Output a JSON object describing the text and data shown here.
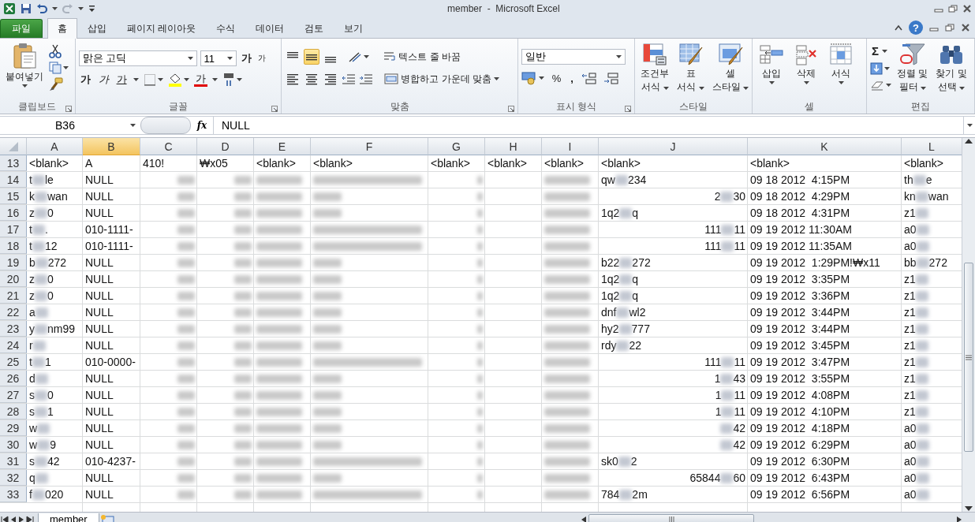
{
  "window": {
    "title": "member  -  Microsoft Excel"
  },
  "ribbon_tabs": [
    {
      "label": "파일",
      "kind": "file",
      "selected": false
    },
    {
      "label": "홈",
      "kind": "tab",
      "selected": true
    },
    {
      "label": "삽입",
      "kind": "tab",
      "selected": false
    },
    {
      "label": "페이지 레이아웃",
      "kind": "tab",
      "selected": false
    },
    {
      "label": "수식",
      "kind": "tab",
      "selected": false
    },
    {
      "label": "데이터",
      "kind": "tab",
      "selected": false
    },
    {
      "label": "검토",
      "kind": "tab",
      "selected": false
    },
    {
      "label": "보기",
      "kind": "tab",
      "selected": false
    }
  ],
  "help": "?",
  "clipboard": {
    "label": "클립보드",
    "paste": "붙여넣기"
  },
  "font": {
    "label": "글꼴",
    "family": "맑은 고딕",
    "size": "11",
    "grow": "가",
    "shrink": "가",
    "bold": "가",
    "italic": "가",
    "underline": "가",
    "color_letter": "가"
  },
  "alignment": {
    "label": "맞춤",
    "vertical": [
      {
        "selected": false
      },
      {
        "selected": true
      },
      {
        "selected": false
      }
    ],
    "wrap": "텍스트 줄 바꿈",
    "merge": "병합하고 가운데 맞춤"
  },
  "number": {
    "label": "표시 형식",
    "format": "일반",
    "percent": "%",
    "comma": ","
  },
  "styles": {
    "label": "스타일",
    "buttons": [
      {
        "kind": "conditional",
        "line1": "조건부",
        "line2": "서식"
      },
      {
        "kind": "table",
        "line1": "표",
        "line2": "서식"
      },
      {
        "kind": "cell",
        "line1": "셀",
        "line2": "스타일"
      }
    ]
  },
  "cells": {
    "label": "셀",
    "buttons": [
      {
        "kind": "insert",
        "label": "삽입"
      },
      {
        "kind": "delete",
        "label": "삭제"
      },
      {
        "kind": "format",
        "label": "서식"
      }
    ]
  },
  "editing": {
    "label": "편집",
    "sigma": "Σ",
    "buttons": [
      {
        "kind": "sort",
        "line1": "정렬 및",
        "line2": "필터"
      },
      {
        "kind": "find",
        "line1": "찾기 및",
        "line2": "선택"
      }
    ]
  },
  "formula_bar": {
    "name_box": "B36",
    "fx": "fx",
    "value": "NULL"
  },
  "sheet": {
    "columns": [
      {
        "label": "A",
        "selected": false
      },
      {
        "label": "B",
        "selected": true
      },
      {
        "label": "C",
        "selected": false
      },
      {
        "label": "D",
        "selected": false
      },
      {
        "label": "E",
        "selected": false
      },
      {
        "label": "F",
        "selected": false
      },
      {
        "label": "G",
        "selected": false
      },
      {
        "label": "H",
        "selected": false
      },
      {
        "label": "I",
        "selected": false
      },
      {
        "label": "J",
        "selected": false
      },
      {
        "label": "K",
        "selected": false
      },
      {
        "label": "L",
        "selected": false
      }
    ],
    "rows": [
      {
        "header": "13",
        "cells": [
          "<blank>",
          "A",
          "410!",
          "₩x05",
          "<blank>",
          "<blank>",
          "<blank>",
          "<blank>",
          "<blank>",
          "<blank>",
          "<blank>",
          "<blank>"
        ]
      },
      {
        "header": "14",
        "cells": [
          {
            "kind": "text",
            "parts": [
              "t",
              "le"
            ]
          },
          "NULL",
          {
            "kind": "short"
          },
          {
            "kind": "short"
          },
          {
            "kind": "medium"
          },
          {
            "kind": "long"
          },
          {
            "kind": "tiny"
          },
          {
            "kind": "empty"
          },
          {
            "kind": "medium"
          },
          {
            "kind": "text",
            "parts": [
              "qw",
              "234"
            ]
          },
          "09 18 2012  4:15PM",
          {
            "kind": "text",
            "parts": [
              "th",
              "e"
            ]
          }
        ]
      },
      {
        "header": "15",
        "cells": [
          {
            "kind": "text",
            "parts": [
              "k",
              "wan"
            ]
          },
          "NULL",
          {
            "kind": "short"
          },
          {
            "kind": "short"
          },
          {
            "kind": "medium"
          },
          {
            "kind": "brief"
          },
          {
            "kind": "tiny"
          },
          {
            "kind": "empty"
          },
          {
            "kind": "medium"
          },
          {
            "kind": "number",
            "parts": [
              "2",
              "30"
            ]
          },
          "09 18 2012  4:29PM",
          {
            "kind": "text",
            "parts": [
              "kn",
              "wan"
            ]
          }
        ]
      },
      {
        "header": "16",
        "cells": [
          {
            "kind": "text",
            "parts": [
              "z",
              "0"
            ]
          },
          "NULL",
          {
            "kind": "short"
          },
          {
            "kind": "short"
          },
          {
            "kind": "medium"
          },
          {
            "kind": "brief"
          },
          {
            "kind": "tiny"
          },
          {
            "kind": "empty"
          },
          {
            "kind": "medium"
          },
          {
            "kind": "text",
            "parts": [
              "1q2",
              "q"
            ]
          },
          "09 18 2012  4:31PM",
          {
            "kind": "text",
            "parts": [
              "z1"
            ],
            "trail": true
          }
        ]
      },
      {
        "header": "17",
        "cells": [
          {
            "kind": "text",
            "parts": [
              "t",
              "."
            ]
          },
          "010-1111-",
          {
            "kind": "short"
          },
          {
            "kind": "short"
          },
          {
            "kind": "medium"
          },
          {
            "kind": "long"
          },
          {
            "kind": "tiny"
          },
          {
            "kind": "empty"
          },
          {
            "kind": "medium"
          },
          {
            "kind": "number",
            "parts": [
              "111",
              "11"
            ]
          },
          "09 19 2012 11:30AM",
          {
            "kind": "text",
            "parts": [
              "a0"
            ],
            "trail": true
          }
        ]
      },
      {
        "header": "18",
        "cells": [
          {
            "kind": "text",
            "parts": [
              "t",
              "12"
            ]
          },
          "010-1111-",
          {
            "kind": "short"
          },
          {
            "kind": "short"
          },
          {
            "kind": "medium"
          },
          {
            "kind": "long"
          },
          {
            "kind": "tiny"
          },
          {
            "kind": "empty"
          },
          {
            "kind": "medium"
          },
          {
            "kind": "number",
            "parts": [
              "111",
              "11"
            ]
          },
          "09 19 2012 11:35AM",
          {
            "kind": "text",
            "parts": [
              "a0"
            ],
            "trail": true
          }
        ]
      },
      {
        "header": "19",
        "cells": [
          {
            "kind": "text",
            "parts": [
              "b",
              "272"
            ]
          },
          "NULL",
          {
            "kind": "short"
          },
          {
            "kind": "short"
          },
          {
            "kind": "medium"
          },
          {
            "kind": "brief"
          },
          {
            "kind": "tiny"
          },
          {
            "kind": "empty"
          },
          {
            "kind": "medium"
          },
          {
            "kind": "text",
            "parts": [
              "b22",
              "272"
            ]
          },
          "09 19 2012  1:29PM!₩x11",
          {
            "kind": "text",
            "parts": [
              "bb",
              "272"
            ]
          }
        ]
      },
      {
        "header": "20",
        "cells": [
          {
            "kind": "text",
            "parts": [
              "z",
              "0"
            ]
          },
          "NULL",
          {
            "kind": "short"
          },
          {
            "kind": "short"
          },
          {
            "kind": "medium"
          },
          {
            "kind": "brief"
          },
          {
            "kind": "tiny"
          },
          {
            "kind": "empty"
          },
          {
            "kind": "medium"
          },
          {
            "kind": "text",
            "parts": [
              "1q2",
              "q"
            ]
          },
          "09 19 2012  3:35PM",
          {
            "kind": "text",
            "parts": [
              "z1"
            ],
            "trail": true
          }
        ]
      },
      {
        "header": "21",
        "cells": [
          {
            "kind": "text",
            "parts": [
              "z",
              "0"
            ]
          },
          "NULL",
          {
            "kind": "short"
          },
          {
            "kind": "short"
          },
          {
            "kind": "medium"
          },
          {
            "kind": "brief"
          },
          {
            "kind": "tiny"
          },
          {
            "kind": "empty"
          },
          {
            "kind": "medium"
          },
          {
            "kind": "text",
            "parts": [
              "1q2",
              "q"
            ]
          },
          "09 19 2012  3:36PM",
          {
            "kind": "text",
            "parts": [
              "z1"
            ],
            "trail": true
          }
        ]
      },
      {
        "header": "22",
        "cells": [
          {
            "kind": "text",
            "parts": [
              "a"
            ],
            "trail": true
          },
          "NULL",
          {
            "kind": "short"
          },
          {
            "kind": "short"
          },
          {
            "kind": "medium"
          },
          {
            "kind": "brief"
          },
          {
            "kind": "tiny"
          },
          {
            "kind": "empty"
          },
          {
            "kind": "medium"
          },
          {
            "kind": "text",
            "parts": [
              "dnf",
              "wl2"
            ]
          },
          "09 19 2012  3:44PM",
          {
            "kind": "text",
            "parts": [
              "z1"
            ],
            "trail": true
          }
        ]
      },
      {
        "header": "23",
        "cells": [
          {
            "kind": "text",
            "parts": [
              "y",
              "nm99"
            ]
          },
          "NULL",
          {
            "kind": "short"
          },
          {
            "kind": "short"
          },
          {
            "kind": "medium"
          },
          {
            "kind": "brief"
          },
          {
            "kind": "tiny"
          },
          {
            "kind": "empty"
          },
          {
            "kind": "medium"
          },
          {
            "kind": "text",
            "parts": [
              "hy2",
              "777"
            ]
          },
          "09 19 2012  3:44PM",
          {
            "kind": "text",
            "parts": [
              "z1"
            ],
            "trail": true
          }
        ]
      },
      {
        "header": "24",
        "cells": [
          {
            "kind": "text",
            "parts": [
              "r"
            ],
            "trail": true
          },
          "NULL",
          {
            "kind": "short"
          },
          {
            "kind": "short"
          },
          {
            "kind": "medium"
          },
          {
            "kind": "brief"
          },
          {
            "kind": "tiny"
          },
          {
            "kind": "empty"
          },
          {
            "kind": "medium"
          },
          {
            "kind": "text",
            "parts": [
              "rdy",
              "22"
            ]
          },
          "09 19 2012  3:45PM",
          {
            "kind": "text",
            "parts": [
              "z1"
            ],
            "trail": true
          }
        ]
      },
      {
        "header": "25",
        "cells": [
          {
            "kind": "text",
            "parts": [
              "t",
              "1"
            ]
          },
          "010-0000-",
          {
            "kind": "short"
          },
          {
            "kind": "short"
          },
          {
            "kind": "medium"
          },
          {
            "kind": "long"
          },
          {
            "kind": "tiny"
          },
          {
            "kind": "empty"
          },
          {
            "kind": "medium"
          },
          {
            "kind": "number",
            "parts": [
              "111",
              "11"
            ]
          },
          "09 19 2012  3:47PM",
          {
            "kind": "text",
            "parts": [
              "z1"
            ],
            "trail": true
          }
        ]
      },
      {
        "header": "26",
        "cells": [
          {
            "kind": "text",
            "parts": [
              "d"
            ],
            "trail": true
          },
          "NULL",
          {
            "kind": "short"
          },
          {
            "kind": "short"
          },
          {
            "kind": "medium"
          },
          {
            "kind": "brief"
          },
          {
            "kind": "tiny"
          },
          {
            "kind": "empty"
          },
          {
            "kind": "medium"
          },
          {
            "kind": "number",
            "parts": [
              "1",
              "43"
            ]
          },
          "09 19 2012  3:55PM",
          {
            "kind": "text",
            "parts": [
              "z1"
            ],
            "trail": true
          }
        ]
      },
      {
        "header": "27",
        "cells": [
          {
            "kind": "text",
            "parts": [
              "s",
              "0"
            ]
          },
          "NULL",
          {
            "kind": "short"
          },
          {
            "kind": "short"
          },
          {
            "kind": "medium"
          },
          {
            "kind": "brief"
          },
          {
            "kind": "tiny"
          },
          {
            "kind": "empty"
          },
          {
            "kind": "medium"
          },
          {
            "kind": "number",
            "parts": [
              "1",
              "11"
            ]
          },
          "09 19 2012  4:08PM",
          {
            "kind": "text",
            "parts": [
              "z1"
            ],
            "trail": true
          }
        ]
      },
      {
        "header": "28",
        "cells": [
          {
            "kind": "text",
            "parts": [
              "s",
              "1"
            ]
          },
          "NULL",
          {
            "kind": "short"
          },
          {
            "kind": "short"
          },
          {
            "kind": "medium"
          },
          {
            "kind": "brief"
          },
          {
            "kind": "tiny"
          },
          {
            "kind": "empty"
          },
          {
            "kind": "medium"
          },
          {
            "kind": "number",
            "parts": [
              "1",
              "11"
            ]
          },
          "09 19 2012  4:10PM",
          {
            "kind": "text",
            "parts": [
              "z1"
            ],
            "trail": true
          }
        ]
      },
      {
        "header": "29",
        "cells": [
          {
            "kind": "text",
            "parts": [
              "w"
            ],
            "trail": true
          },
          "NULL",
          {
            "kind": "short"
          },
          {
            "kind": "short"
          },
          {
            "kind": "medium"
          },
          {
            "kind": "brief"
          },
          {
            "kind": "tiny"
          },
          {
            "kind": "empty"
          },
          {
            "kind": "medium"
          },
          {
            "kind": "number",
            "parts": [
              "42"
            ],
            "lead": true
          },
          "09 19 2012  4:18PM",
          {
            "kind": "text",
            "parts": [
              "a0"
            ],
            "trail": true
          }
        ]
      },
      {
        "header": "30",
        "cells": [
          {
            "kind": "text",
            "parts": [
              "w",
              "9"
            ]
          },
          "NULL",
          {
            "kind": "short"
          },
          {
            "kind": "short"
          },
          {
            "kind": "medium"
          },
          {
            "kind": "brief"
          },
          {
            "kind": "tiny"
          },
          {
            "kind": "empty"
          },
          {
            "kind": "medium"
          },
          {
            "kind": "number",
            "parts": [
              "42"
            ],
            "lead": true
          },
          "09 19 2012  6:29PM",
          {
            "kind": "text",
            "parts": [
              "a0"
            ],
            "trail": true
          }
        ]
      },
      {
        "header": "31",
        "cells": [
          {
            "kind": "text",
            "parts": [
              "s",
              "42"
            ]
          },
          "010-4237-",
          {
            "kind": "short"
          },
          {
            "kind": "short"
          },
          {
            "kind": "medium"
          },
          {
            "kind": "long"
          },
          {
            "kind": "tiny"
          },
          {
            "kind": "empty"
          },
          {
            "kind": "medium"
          },
          {
            "kind": "text",
            "parts": [
              "sk0",
              "2"
            ]
          },
          "09 19 2012  6:30PM",
          {
            "kind": "text",
            "parts": [
              "a0"
            ],
            "trail": true
          }
        ]
      },
      {
        "header": "32",
        "cells": [
          {
            "kind": "text",
            "parts": [
              "q"
            ],
            "trail": true
          },
          "NULL",
          {
            "kind": "short"
          },
          {
            "kind": "short"
          },
          {
            "kind": "medium"
          },
          {
            "kind": "brief"
          },
          {
            "kind": "tiny"
          },
          {
            "kind": "empty"
          },
          {
            "kind": "medium"
          },
          {
            "kind": "number",
            "parts": [
              "65844",
              "60"
            ]
          },
          "09 19 2012  6:43PM",
          {
            "kind": "text",
            "parts": [
              "a0"
            ],
            "trail": true
          }
        ]
      },
      {
        "header": "33",
        "cells": [
          {
            "kind": "text",
            "parts": [
              "f",
              "020"
            ]
          },
          "NULL",
          {
            "kind": "short"
          },
          {
            "kind": "short"
          },
          {
            "kind": "medium"
          },
          {
            "kind": "long"
          },
          {
            "kind": "tiny"
          },
          {
            "kind": "empty"
          },
          {
            "kind": "medium"
          },
          {
            "kind": "text",
            "parts": [
              "784",
              "2m"
            ]
          },
          "09 19 2012  6:56PM",
          {
            "kind": "text",
            "parts": [
              "a0"
            ],
            "trail": true
          }
        ]
      }
    ]
  },
  "sheet_tabs": [
    {
      "label": "member",
      "selected": true
    }
  ]
}
